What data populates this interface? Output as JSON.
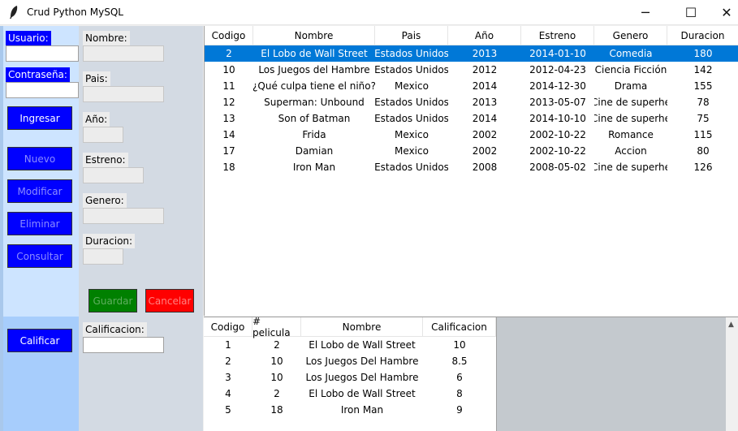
{
  "window": {
    "title": "Crud Python MySQL",
    "icon": "feather-icon",
    "controls": {
      "minimize": "─",
      "maximize": "☐",
      "close": "✕"
    }
  },
  "login": {
    "usuario_label": "Usuario:",
    "usuario_value": "",
    "contrasena_label": "Contraseña:",
    "contrasena_value": "",
    "ingresar_label": "Ingresar"
  },
  "actions": {
    "nuevo": "Nuevo",
    "modificar": "Modificar",
    "eliminar": "Eliminar",
    "consultar": "Consultar",
    "calificar": "Calificar"
  },
  "form": {
    "nombre_label": "Nombre:",
    "nombre_value": "",
    "pais_label": "Pais:",
    "pais_value": "",
    "anio_label": "Año:",
    "anio_value": "",
    "estreno_label": "Estreno:",
    "estreno_value": "",
    "genero_label": "Genero:",
    "genero_value": "",
    "duracion_label": "Duracion:",
    "duracion_value": "",
    "guardar": "Guardar",
    "cancelar": "Cancelar",
    "calificacion_label": "Calificacion:",
    "calificacion_value": ""
  },
  "peliculas": {
    "columns": [
      "Codigo",
      "Nombre",
      "Pais",
      "Año",
      "Estreno",
      "Genero",
      "Duracion"
    ],
    "selected_index": 0,
    "rows": [
      [
        "2",
        "El Lobo de Wall Street",
        "Estados Unidos",
        "2013",
        "2014-01-10",
        "Comedia",
        "180"
      ],
      [
        "10",
        "Los Juegos del Hambre",
        "Estados Unidos",
        "2012",
        "2012-04-23",
        "Ciencia Ficción",
        "142"
      ],
      [
        "11",
        "¿Qué culpa tiene el niño?",
        "Mexico",
        "2014",
        "2014-12-30",
        "Drama",
        "155"
      ],
      [
        "12",
        "Superman: Unbound",
        "Estados Unidos",
        "2013",
        "2013-05-07",
        "Cine de superhe",
        "78"
      ],
      [
        "13",
        "Son of Batman",
        "Estados Unidos",
        "2014",
        "2014-10-10",
        "Cine de superhe",
        "75"
      ],
      [
        "14",
        "Frida",
        "Mexico",
        "2002",
        "2002-10-22",
        "Romance",
        "115"
      ],
      [
        "17",
        "Damian",
        "Mexico",
        "2002",
        "2002-10-22",
        "Accion",
        "80"
      ],
      [
        "18",
        "Iron Man",
        "Estados Unidos",
        "2008",
        "2008-05-02",
        "Cine de superhe",
        "126"
      ]
    ]
  },
  "calificaciones": {
    "columns": [
      "Codigo",
      "# pelicula",
      "Nombre",
      "Calificacion"
    ],
    "rows": [
      [
        "1",
        "2",
        "El Lobo de Wall Street",
        "10"
      ],
      [
        "2",
        "10",
        "Los Juegos Del Hambre",
        "8.5"
      ],
      [
        "3",
        "10",
        "Los Juegos Del Hambre",
        "6"
      ],
      [
        "4",
        "2",
        "El Lobo de Wall Street",
        "8"
      ],
      [
        "5",
        "18",
        "Iron Man",
        "9"
      ]
    ]
  },
  "scrollbar": {
    "up_arrow": "▲"
  },
  "colors": {
    "selection": "#0078d7",
    "button_blue": "#0000ff",
    "button_green": "#008000",
    "button_red": "#ff0000"
  }
}
